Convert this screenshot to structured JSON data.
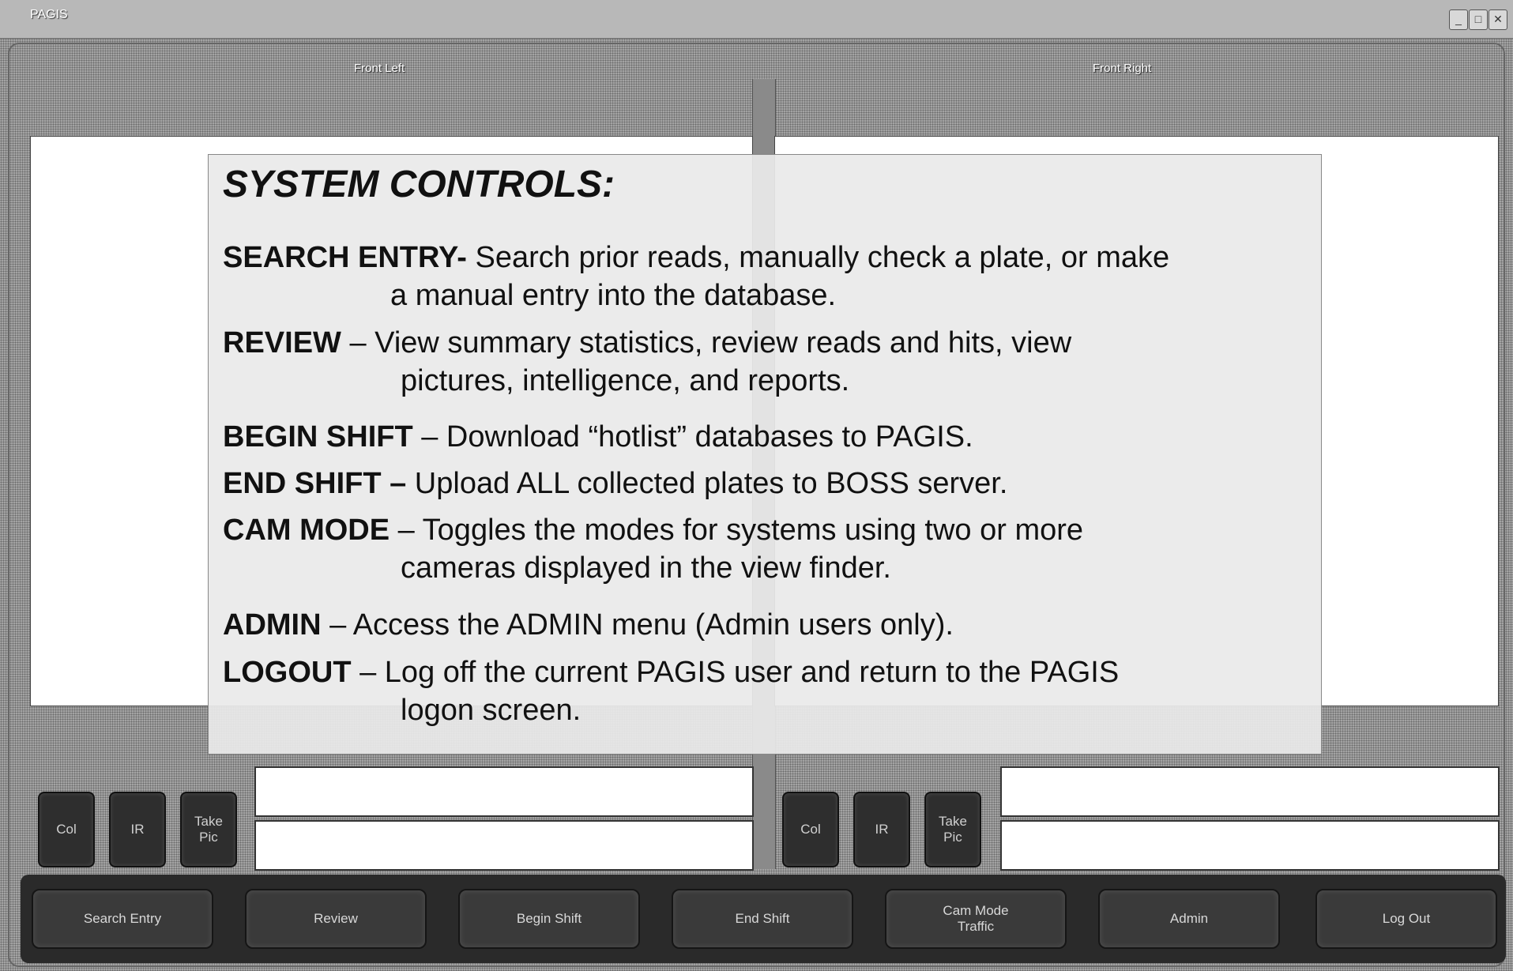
{
  "window": {
    "title": "PAGIS"
  },
  "cameras": {
    "left": {
      "label": "Front Left",
      "buttons": [
        "Col",
        "IR",
        "Take\nPic"
      ]
    },
    "right": {
      "label": "Front Right",
      "buttons": [
        "Col",
        "IR",
        "Take\nPic"
      ]
    }
  },
  "toolbar": {
    "buttons": [
      "Search Entry",
      "Review",
      "Begin Shift",
      "End Shift",
      "Cam Mode\nTraffic",
      "Admin",
      "Log Out"
    ]
  },
  "overlay": {
    "title": "SYSTEM CONTROLS:",
    "entries": [
      {
        "key": "SEARCH ENTRY-",
        "text": " Search prior reads, manually check a plate, or make",
        "cont": "a manual entry into the database."
      },
      {
        "key": "REVIEW",
        "text": " – View summary statistics, review reads and hits, view",
        "cont": "pictures, intelligence, and reports."
      },
      {
        "key": "BEGIN SHIFT",
        "text": " – Download “hotlist” databases to PAGIS.",
        "cont": ""
      },
      {
        "key": "END SHIFT –",
        "text": " Upload ALL collected plates to BOSS server.",
        "cont": ""
      },
      {
        "key": "CAM MODE",
        "text": " – Toggles the modes for systems using two or more",
        "cont": "cameras displayed in the view finder."
      },
      {
        "key": "ADMIN",
        "text": " – Access the ADMIN menu (Admin users only).",
        "cont": ""
      },
      {
        "key": "LOGOUT",
        "text": " – Log off the current PAGIS user and return to the PAGIS",
        "cont": "logon screen."
      }
    ]
  }
}
